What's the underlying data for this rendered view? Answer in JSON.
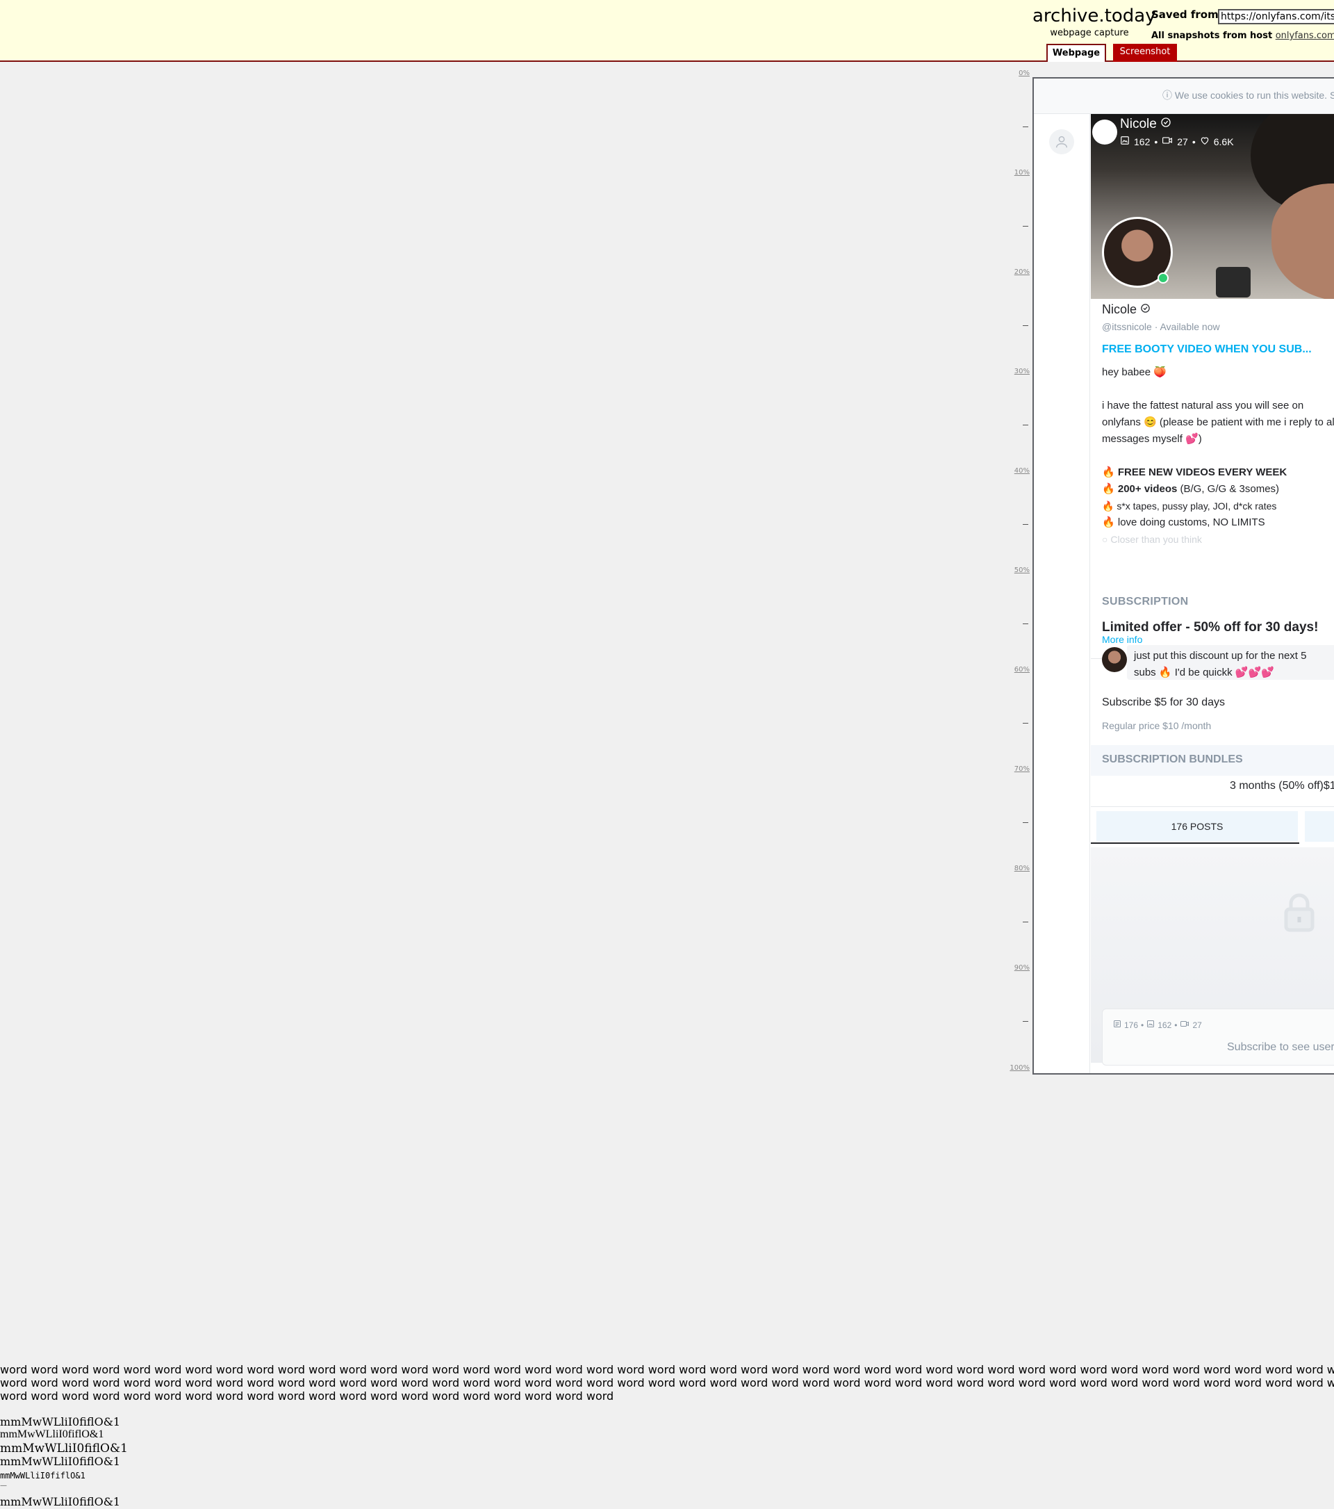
{
  "archive": {
    "brand": "archive.today",
    "subtitle": "webpage capture",
    "saved_from_label": "Saved from",
    "url": "https://onlyfans.com/itssnicole",
    "all_snapshots_label": "All snapshots from host",
    "host": "onlyfans.com",
    "tabs": [
      "Webpage",
      "Screenshot"
    ],
    "ruler": [
      "0%",
      "10%",
      "20%",
      "30%",
      "40%",
      "50%",
      "60%",
      "70%",
      "80%",
      "90%",
      "100%"
    ]
  },
  "page": {
    "cookie_text": "We use cookies to run this website. S",
    "cover": {
      "name": "Nicole",
      "photos": "162",
      "videos": "27",
      "likes": "6.6K",
      "sep": "•"
    },
    "profile": {
      "name": "Nicole",
      "handle": "@itssnicole",
      "status": "Available now",
      "headline": "FREE BOOTY VIDEO WHEN YOU SUB..."
    },
    "bio": {
      "line1": "hey babee 🍑",
      "line2": "i have the fattest natural ass you will see on onlyfans 😊 (please be patient with me i reply to all messages myself 💕)",
      "b1_bold": "FREE NEW VIDEOS EVERY WEEK",
      "b2_bold": "200+ videos",
      "b2_rest": " (B/G, G/G & 3somes)",
      "b3": "s*x tapes, pussy play, JOI, d*ck rates",
      "b4": "love doing customs, NO LIMITS",
      "b5": "Closer than you think",
      "more": "More info",
      "bullet": "🔥"
    },
    "subscription": {
      "title": "SUBSCRIPTION",
      "offer": "Limited offer - 50% off for 30 days!",
      "message": "just put this discount up for the next 5 subs 🔥 I'd be quickk 💕💕💕",
      "price": "Subscribe $5 for 30 days",
      "regular": "Regular price $10 /month"
    },
    "bundles": {
      "title": "SUBSCRIPTION BUNDLES",
      "row": "3 months (50% off)$1"
    },
    "tabs": {
      "posts": "176 POSTS"
    },
    "locked": {
      "posts": "176",
      "photos": "162",
      "videos": "27",
      "sep": "•",
      "text": "Subscribe to see user'"
    }
  },
  "font_probe": {
    "words_line1": "word word word word word word word word word word word word word word word word word word word word word word word word word word word word word word word word word word word word word word word word word word word word word word word word word word w",
    "words_line2": "word word word word word word word word word word word word word word word word word word word word word word word word word word word word word word word word word word word word word word word word word word word word word word word word word word w",
    "words_line3": "word word word word word word word word word word word word word word word word word word word word",
    "sample": "mmMwWLliI0fiflO&1",
    "dash": "—"
  },
  "colors": {
    "header_bg": "#ffffe0",
    "header_border": "#7f1010",
    "screenshot_tab": "#b40000",
    "accent": "#00aff0",
    "online": "#2ecc71"
  }
}
